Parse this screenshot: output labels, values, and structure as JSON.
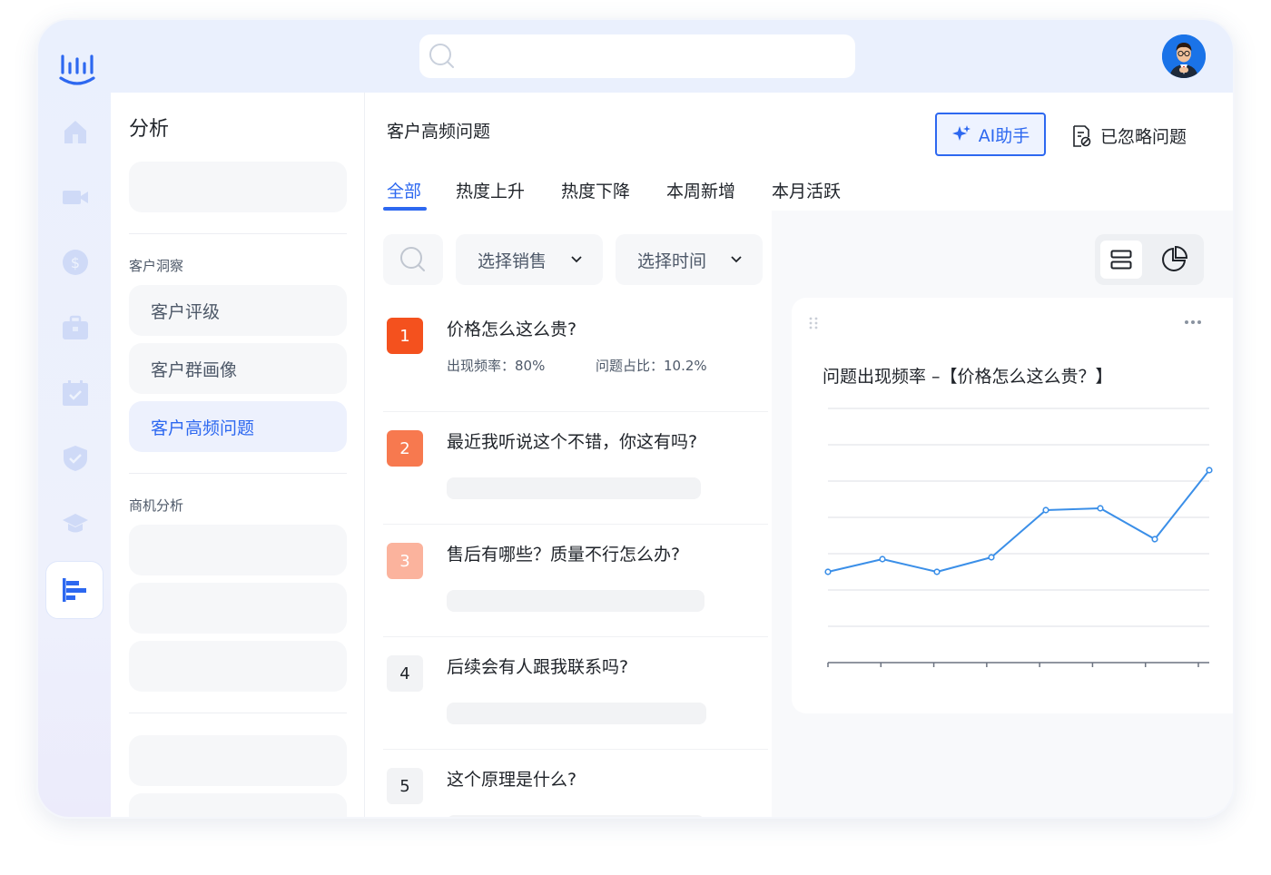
{
  "search": {
    "placeholder": ""
  },
  "sidebar": {
    "title": "分析",
    "sections": [
      {
        "label": "客户洞察",
        "items": [
          {
            "label": "客户评级"
          },
          {
            "label": "客户群画像"
          },
          {
            "label": "客户高频问题"
          }
        ]
      },
      {
        "label": "商机分析"
      }
    ],
    "active_item": "客户高频问题"
  },
  "main": {
    "title": "客户高频问题",
    "ai_button": "AI助手",
    "ignored_link": "已忽略问题",
    "tabs": [
      {
        "label": "全部"
      },
      {
        "label": "热度上升"
      },
      {
        "label": "热度下降"
      },
      {
        "label": "本周新增"
      },
      {
        "label": "本月活跃"
      }
    ],
    "active_tab": "全部",
    "filters": {
      "sales": "选择销售",
      "time": "选择时间"
    },
    "questions": [
      {
        "rank": "1",
        "text": "价格怎么这么贵?",
        "freq": "出现频率：80%",
        "share": "问题占比：10.2%"
      },
      {
        "rank": "2",
        "text": "最近我听说这个不错，你这有吗?"
      },
      {
        "rank": "3",
        "text": "售后有哪些？质量不行怎么办?"
      },
      {
        "rank": "4",
        "text": "后续会有人跟我联系吗?"
      },
      {
        "rank": "5",
        "text": "这个原理是什么?"
      }
    ]
  },
  "colors": {
    "accent": "#2d68f0",
    "rank1": "#f4511e",
    "rank2": "#f7794f",
    "rank3": "#fbb39d",
    "line": "#3b8fe8"
  },
  "chart_data": {
    "type": "line",
    "title": "问题出现频率 –【价格怎么这么贵？】",
    "x": [
      0,
      1,
      2,
      3,
      4,
      5,
      6,
      7
    ],
    "values": [
      2.5,
      2.85,
      2.5,
      2.9,
      4.2,
      4.25,
      3.4,
      5.3
    ],
    "ylim": [
      0,
      7
    ],
    "grid": true,
    "x_ticks": 8
  }
}
